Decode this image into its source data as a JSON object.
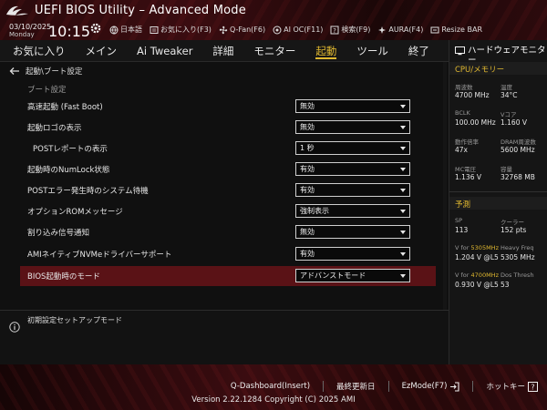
{
  "header": {
    "title": "UEFI BIOS Utility – Advanced Mode",
    "date": "03/10/2025",
    "day": "Monday",
    "time": "10:15",
    "tools": [
      {
        "label": "日本語",
        "icon": "globe-icon"
      },
      {
        "label": "お気に入り(F3)",
        "icon": "favorite-icon"
      },
      {
        "label": "Q-Fan(F6)",
        "icon": "fan-icon"
      },
      {
        "label": "AI OC(F11)",
        "icon": "ai-oc-icon"
      },
      {
        "label": "検索(F9)",
        "icon": "search-help-icon"
      },
      {
        "label": "AURA(F4)",
        "icon": "aura-icon"
      },
      {
        "label": "Resize BAR",
        "icon": "resize-bar-icon"
      }
    ]
  },
  "menu": {
    "items": [
      "お気に入り",
      "メイン",
      "Ai Tweaker",
      "詳細",
      "モニター",
      "起動",
      "ツール",
      "終了"
    ],
    "active_index": 5
  },
  "main": {
    "breadcrumb": "起動\\ブート設定",
    "section": "ブート設定",
    "settings": [
      {
        "label": "高速起動 (Fast Boot)",
        "value": "無効"
      },
      {
        "label": "起動ロゴの表示",
        "value": "無効"
      },
      {
        "label": "POSTレポートの表示",
        "value": "1 秒"
      },
      {
        "label": "起動時のNumLock状態",
        "value": "有効"
      },
      {
        "label": "POSTエラー発生時のシステム待機",
        "value": "有効"
      },
      {
        "label": "オプションROMメッセージ",
        "value": "強制表示"
      },
      {
        "label": "割り込み信号通知",
        "value": "無効"
      },
      {
        "label": "AMIネイティブNVMeドライバーサポート",
        "value": "有効"
      },
      {
        "label": "BIOS起動時のモード",
        "value": "アドバンストモード"
      }
    ]
  },
  "help": {
    "text": "初期設定セットアップモード"
  },
  "hw": {
    "title": "ハードウェアモニター",
    "cpu_section": "CPU/メモリー",
    "cpu": [
      {
        "k1": "周波数",
        "v1": "4700 MHz",
        "k2": "温度",
        "v2": "34°C"
      },
      {
        "k1": "BCLK",
        "v1": "100.00 MHz",
        "k2": "Vコア",
        "v2": "1.160 V"
      },
      {
        "k1": "動作倍率",
        "v1": "47x",
        "k2": "DRAM周波数",
        "v2": "5600 MHz"
      },
      {
        "k1": "MC電圧",
        "v1": "1.136 V",
        "k2": "容量",
        "v2": "32768 MB"
      }
    ],
    "pred_section": "予測",
    "pred": {
      "sp_k": "SP",
      "sp_v": "113",
      "cooler_k": "クーラー",
      "cooler_v": "152 pts",
      "vfor1_pre": "V for ",
      "vfor1_hl": "5305MHz",
      "heavy_k": "Heavy Freq",
      "vfor1_v": "1.204 V @L5",
      "heavy_v": "5305 MHz",
      "vfor2_pre": "V for ",
      "vfor2_hl": "4700MHz",
      "dos_k": "Dos Thresh",
      "vfor2_v": "0.930 V @L5",
      "dos_v": "53"
    }
  },
  "footer": {
    "qdash": "Q-Dashboard(Insert)",
    "last": "最終更新日",
    "ezmode": "EzMode(F7)",
    "hotkey": "ホットキー",
    "copyright": "Version 2.22.1284 Copyright (C) 2025 AMI"
  },
  "colors": {
    "accent": "#e0b830",
    "selected_row": "#5a1216",
    "header_red": "#3a0c10"
  }
}
